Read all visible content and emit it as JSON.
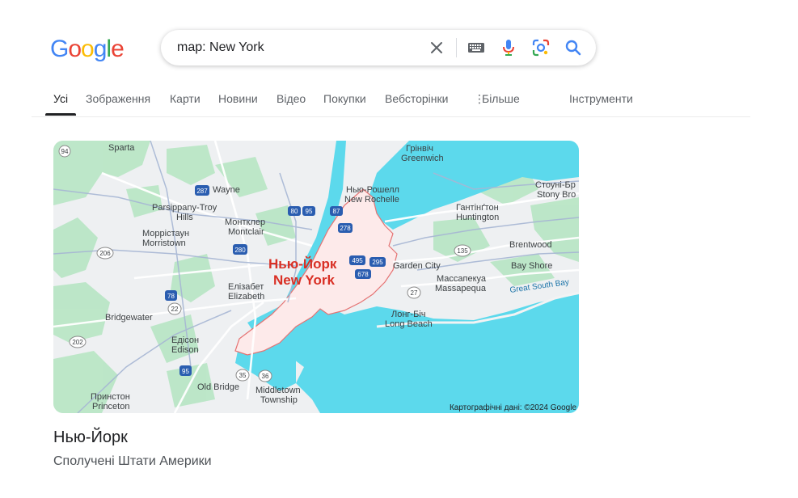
{
  "logo": {
    "letters": [
      "G",
      "o",
      "o",
      "g",
      "l",
      "e"
    ],
    "colors": [
      "#4285f4",
      "#ea4335",
      "#fbbc05",
      "#4285f4",
      "#34a853",
      "#ea4335"
    ]
  },
  "search": {
    "query": "map: New York"
  },
  "tabs": [
    {
      "label": "Усі",
      "active": true
    },
    {
      "label": "Зображення"
    },
    {
      "label": "Карти"
    },
    {
      "label": "Новини"
    },
    {
      "label": "Відео"
    },
    {
      "label": "Покупки"
    },
    {
      "label": "Вебсторінки"
    },
    {
      "label": "Більше"
    }
  ],
  "tools_label": "Інструменти",
  "map": {
    "city_label_uk": "Нью-Йорк",
    "city_label_en": "New York",
    "attribution": "Картографічні дані: ©2024 Google",
    "places": {
      "sparta": "Sparta",
      "wayne": "Wayne",
      "parsippany_uk": "Parsippany-Troy",
      "parsippany_en": "Hills",
      "morristown_uk": "Моррістаун",
      "morristown_en": "Morristown",
      "montclair_uk": "Монтклер",
      "montclair_en": "Montclair",
      "elizabeth_uk": "Елізабет",
      "elizabeth_en": "Elizabeth",
      "bridgewater": "Bridgewater",
      "edison_uk": "Едісон",
      "edison_en": "Edison",
      "princeton_uk": "Принстон",
      "princeton_en": "Princeton",
      "oldbridge": "Old Bridge",
      "middletown_uk": "Middletown",
      "middletown_en": "Township",
      "greenwich_uk": "Грінвіч",
      "greenwich_en": "Greenwich",
      "newrochelle_uk": "Нью-Рошелл",
      "newrochelle_en": "New Rochelle",
      "huntington_uk": "Гантінґтон",
      "huntington_en": "Huntington",
      "stonybrook_uk": "Стоуні-Бр",
      "stonybrook_en": "Stony Bro",
      "brentwood": "Brentwood",
      "bayshore": "Bay Shore",
      "gardencity": "Garden City",
      "massapequa_uk": "Массапекуа",
      "massapequa_en": "Massapequa",
      "longbeach_uk": "Лонг-Біч",
      "longbeach_en": "Long Beach",
      "greatsouthbay": "Great South Bay"
    },
    "shields": [
      "94",
      "287",
      "80",
      "95",
      "87",
      "278",
      "280",
      "206",
      "495",
      "678",
      "295",
      "135",
      "27",
      "78",
      "22",
      "202",
      "95",
      "35",
      "36"
    ]
  },
  "place": {
    "title": "Нью-Йорк",
    "subtitle": "Сполучені Штати Америки"
  }
}
